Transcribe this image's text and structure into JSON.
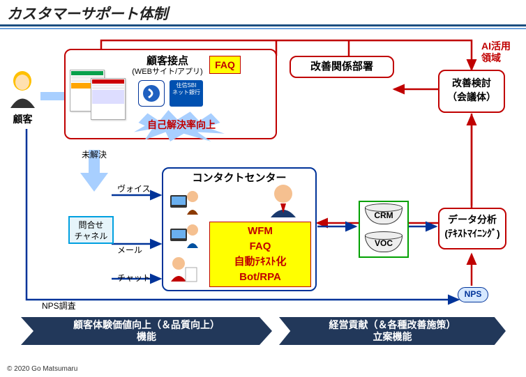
{
  "title": "カスタマーサポート体制",
  "ai_label": "AI活用\n領域",
  "customer_label": "顧客",
  "touchpoint": {
    "title": "顧客接点",
    "subtitle": "(WEBサイト/アプリ)",
    "faq": "FAQ",
    "selfsolve": "自己解決率向上",
    "bank": "住信SBI\nネット銀行"
  },
  "improvement_dept": "改善関係部署",
  "review": "改善検討\n（会議体）",
  "unresolved": "未解決",
  "inquiry_channel": "問合せ\nチャネル",
  "ch": {
    "voice": "ヴォイス",
    "mail": "メール",
    "chat": "チャット"
  },
  "cc": {
    "title": "コンタクトセンター",
    "wfm": "WFM",
    "faq": "FAQ",
    "auto": "自動ﾃｷｽﾄ化",
    "bot": "Bot/RPA"
  },
  "db": {
    "crm": "CRM",
    "voc": "VOC"
  },
  "analysis": "データ分析\n(ﾃｷｽﾄﾏｲﾆﾝｸﾞ)",
  "nps": "NPS",
  "nps_survey": "NPS調査",
  "banner_left": "顧客体験価値向上（＆品質向上）\n機能",
  "banner_right": "経営貢献（＆各種改善施策）\n立案機能",
  "copyright": "© 2020 Go Matsumaru"
}
